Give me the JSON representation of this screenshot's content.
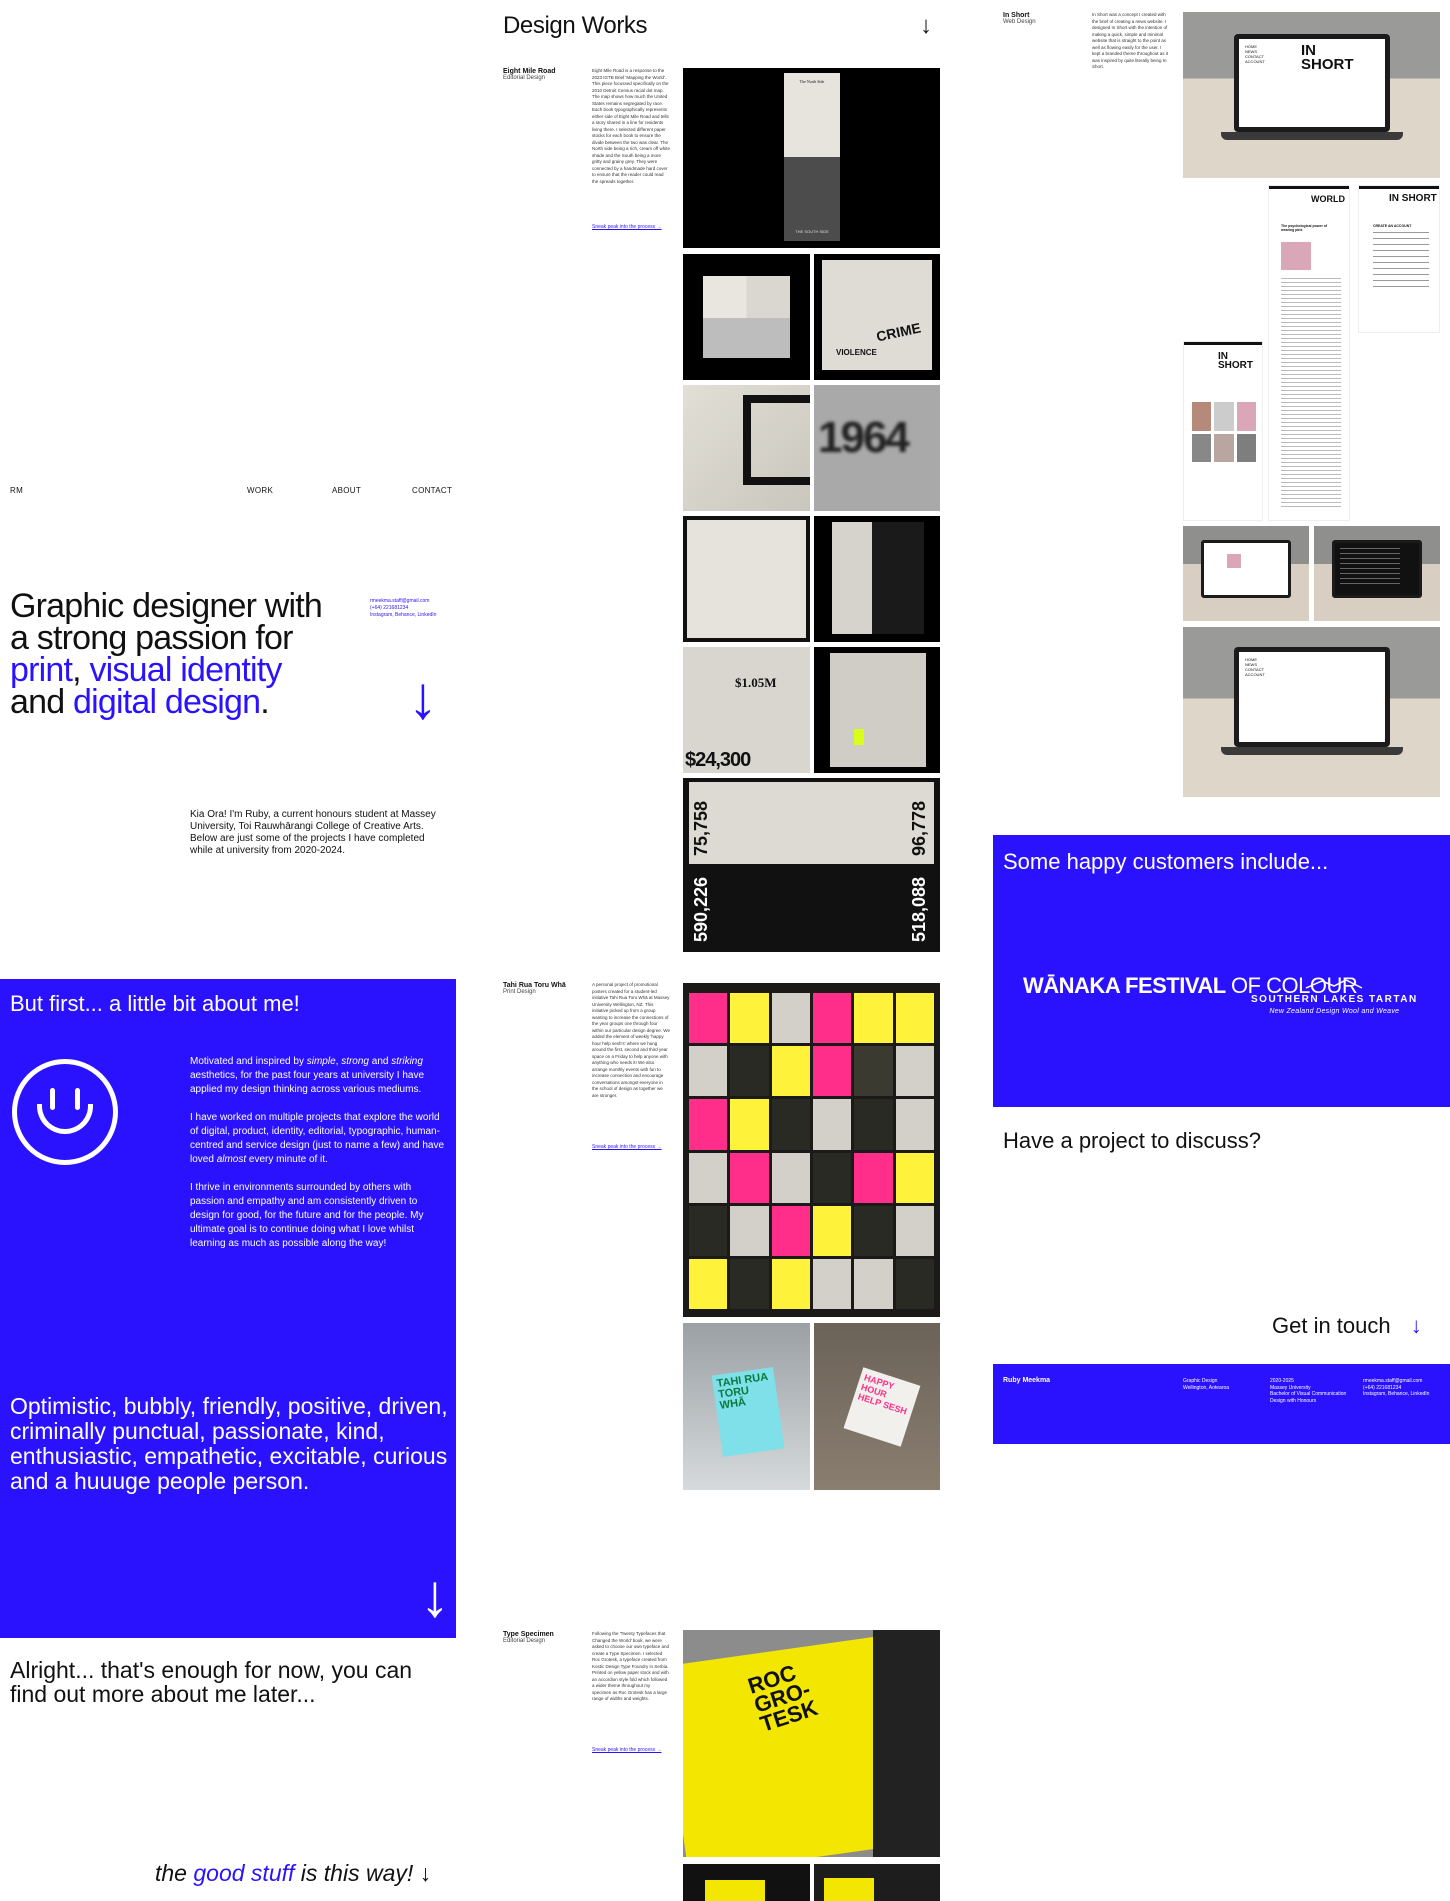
{
  "nav": {
    "logo": "RM",
    "work": "WORK",
    "about": "ABOUT",
    "contact": "CONTACT"
  },
  "hero": {
    "line1": "Graphic designer with",
    "line2": "a strong passion for",
    "print": "print",
    "comma": ",",
    "visual": "visual identity",
    "and": "and",
    "digital": "digital design",
    "period": ".",
    "email": "rmeekma.staff@gmail.com",
    "phone": "(+64) 221681234",
    "socials": "Instagram, Behance, LinkedIn",
    "arrow": "↓",
    "intro": "Kia Ora! I'm Ruby, a current honours student at Massey University, Toi Rauwhārangi College of Creative Arts. Below are just some of the projects I have completed while at university from 2020-2024."
  },
  "about": {
    "heading": "But first... a little bit about me!",
    "p1_a": "Motivated and inspired by ",
    "p1_simple": "simple",
    "p1_b": ", ",
    "p1_strong": "strong",
    "p1_c": " and ",
    "p1_striking": "striking",
    "p1_d": " aesthetics, for the past four years at university I have applied my design thinking across various mediums.",
    "p2_a": "I have worked on multiple projects that explore the world of digital, product, identity, editorial, typographic, human-centred and service design (just to name a few) and have loved ",
    "p2_almost": "almost",
    "p2_b": " every minute of it.",
    "p3": "I thrive in environments surrounded by others with passion and empathy and am consistently driven to design for good, for the future and for the people. My ultimate goal is to continue doing what I love whilst learning as much as possible along the way!",
    "traits": "Optimistic, bubbly, friendly, positive, driven, criminally punctual, passionate, kind, enthusiastic, empathetic, excitable, curious and a huuuge people person.",
    "arrow": "↓",
    "later": "Alright... that's enough for now, you can find out more about me later...",
    "good_a": "the ",
    "good_b": "good stuff",
    "good_c": " is this way! ↓"
  },
  "works": {
    "title": "Design Works",
    "arrow": "↓",
    "sneak": "Sneak peak into the process →",
    "projects": [
      {
        "name": "Eight Mile Road",
        "category": "Editorial Design",
        "desc": "Eight Mile Road is a response to the 2023 IGTB Brief 'Mapping the World'. This piece focussed specifically on the 2010 Detroit Census racial dot map. The map shows how much the United States remains segregated by race. Each book typographically represents either side of Eight Mile Road and tells a story shared in a line for residents living there. I selected different paper stocks for each book to ensure the divide between the two was clear. The North side being a rich, cream off white shade and the South being a more gritty and grainy grey. They were connected by a handmade hard cover to ensure that the reader could read the spreads together."
      },
      {
        "name": "Tahi Rua Toru Whā",
        "category": "Print Design",
        "desc": "A personal project of promotional posters created for a student-led initiative Tahi Rua Toru Whā at Massey University Wellington, NZ. This initiative picked up from a group wanting to increase the connections of the year groups one through four within our particular design degree. We added the element of weekly 'happy hour help sesh's' where we hung around the first, second and third year space on a Friday to help anyone with anything who needs it! We also arrange monthly events with fun to increase connection and encourage conversations amongst everyone in the school of design as together we are stronger."
      },
      {
        "name": "Type Specimen",
        "category": "Editorial Design",
        "desc": "Following the 'Twenty Typefaces that Changed the World' book, we were asked to choose our own typeface and create a Type Specimen. I selected Roc Grotesk, a typeface created from Kostic Design Type Foundry in Serbia. Printed on yellow paper stock and with an accordion style fold which followed a wider theme throughout my specimen as Roc Grotesk has a large range of widths and weights."
      }
    ]
  },
  "inshort": {
    "name": "In Short",
    "category": "Web Design",
    "desc": "In Short was a concept I created with the brief of creating a news website. I designed In Short with the intention of making a quick, simple and minimal website that is straight to the point as well as flowing easily for the user. I kept a branded theme throughout as it was inspired by quite literally being In Short.",
    "screen_title": "IN SHORT",
    "world": "WORLD",
    "menu": [
      "HOME",
      "NEWS",
      "CONTACT",
      "ACCOUNT"
    ],
    "create_account": "CREATE AN ACCOUNT",
    "article": "The psychological power of wearing pink"
  },
  "customers": {
    "heading": "Some happy customers include...",
    "logo1_a": "WĀNAKA FESTIVAL",
    "logo1_b": "OF COLOUR",
    "logo2": "SOUTHERN LAKES TARTAN",
    "logo2_sub": "New Zealand Design Wool and Weave",
    "discuss": "Have a project to discuss?",
    "get_in_touch": "Get in touch",
    "arrow": "↓"
  },
  "footer": {
    "name": "Ruby Meekma",
    "role": "Graphic Design",
    "place": "Wellington, Aotearoa",
    "years": "2020-2025",
    "uni": "Massey University",
    "degree": "Bachelor of Visual Communication Design with Honours",
    "email": "rmeekma.staff@gmail.com",
    "phone": "(+64) 221681234",
    "socials": "Instagram, Behance, LinkedIn"
  },
  "book_text": {
    "cover": "The North Side",
    "south": "THE SOUTH SIDE",
    "n1964": "1964",
    "money": "$1.05M",
    "money2": "$24,300",
    "crime": "CRIME",
    "violence": "VIOLENCE",
    "v1": "75,758",
    "v2": "96,778",
    "v3": "590,226",
    "v4": "518,088",
    "poster": "TAHI RUA TORU WHĀ",
    "happy": "HAPPY HOUR HELP SESH",
    "roc": "ROC GRO- TESK"
  },
  "colors": {
    "accent": "#2a12ff"
  }
}
